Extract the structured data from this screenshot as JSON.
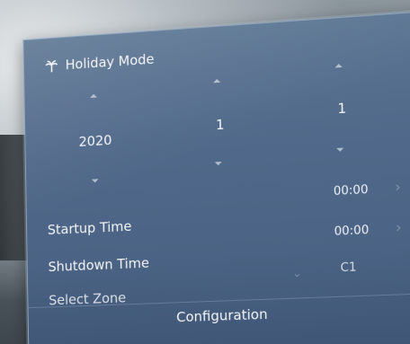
{
  "header": {
    "title": "Holiday Mode",
    "icon": "palm-tree-icon"
  },
  "date_picker": {
    "year": "2020",
    "month": "1",
    "day": "1"
  },
  "settings": {
    "startup_label": "Startup Time",
    "startup_value": "00:00",
    "shutdown_label": "Shutdown Time",
    "shutdown_value": "00:00",
    "zone_label": "Select Zone",
    "zone_value": "C1"
  },
  "footer": {
    "label": "Configuration"
  }
}
